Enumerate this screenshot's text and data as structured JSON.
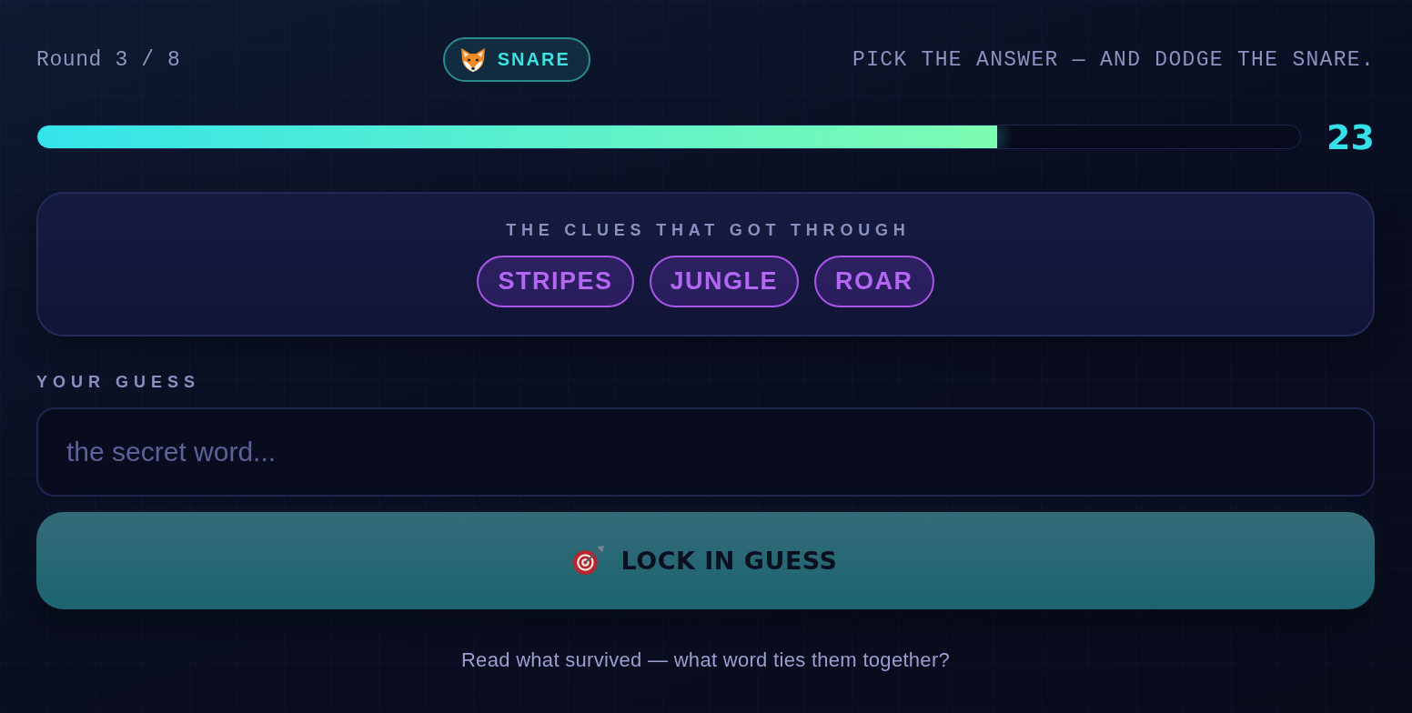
{
  "header": {
    "round": "Round 3 / 8",
    "badge": "SNARE",
    "tagline": "PICK THE ANSWER — AND DODGE THE SNARE."
  },
  "timer": {
    "level": 0.76,
    "reading": "23"
  },
  "clues": {
    "title": "THE CLUES THAT GOT THROUGH",
    "items": [
      "STRIPES",
      "JUNGLE",
      "ROAR"
    ]
  },
  "guess": {
    "label": "YOUR GUESS",
    "placeholder": "the secret word..."
  },
  "submit": {
    "label": "LOCK IN GUESS"
  },
  "footer": "Read what survived — what word ties them together?"
}
